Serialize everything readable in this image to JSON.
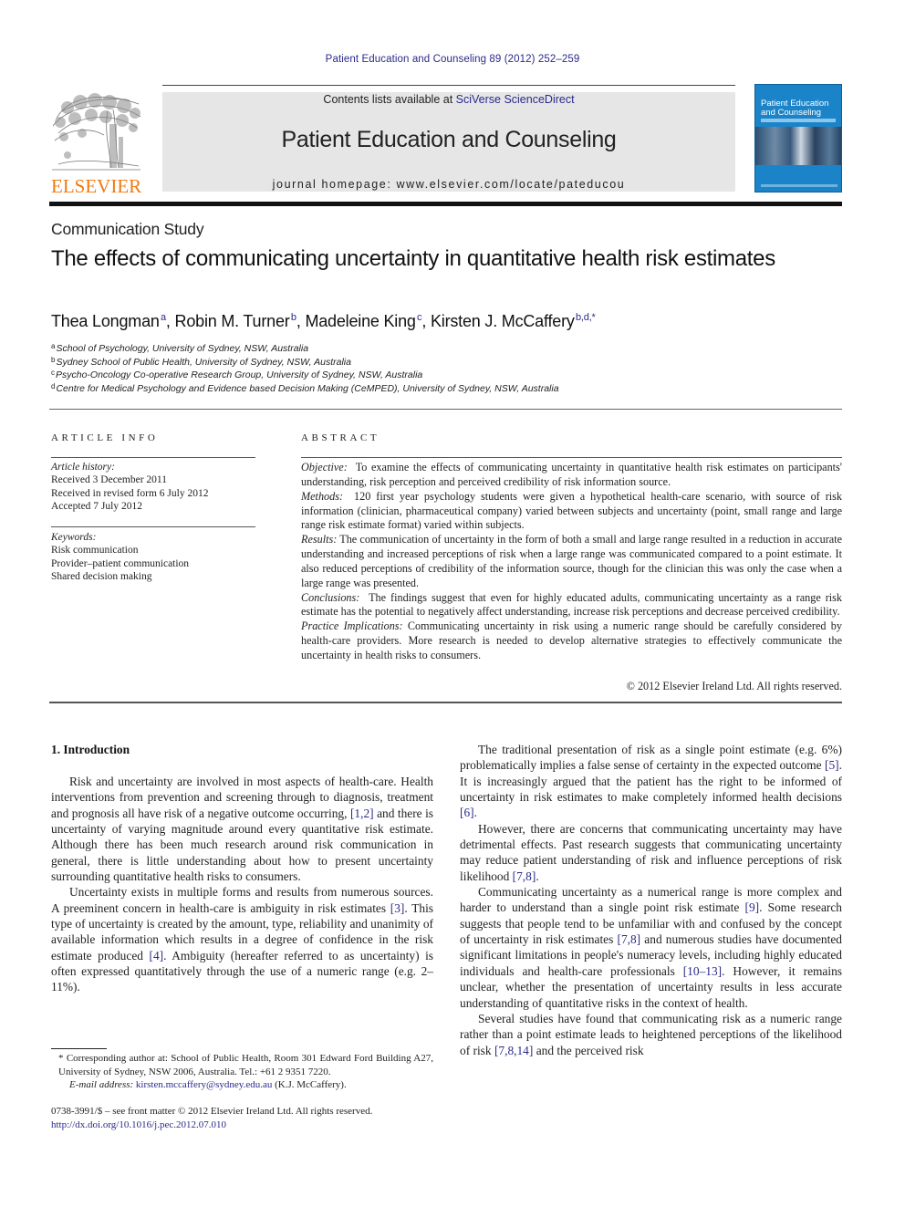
{
  "header": {
    "journal_reference": "Patient Education and Counseling 89 (2012) 252–259",
    "contents_prefix": "Contents lists available at ",
    "contents_link": "SciVerse ScienceDirect",
    "journal_title": "Patient Education and Counseling",
    "homepage": "journal homepage: www.elsevier.com/locate/pateducou",
    "publisher_logo_text": "ELSEVIER",
    "cover": {
      "title_line1": "Patient Education",
      "title_line2": "and Counseling"
    },
    "colors": {
      "link": "#2a2a8c",
      "elsevier_orange": "#f07a10",
      "cover_blue": "#1b84c8"
    }
  },
  "article": {
    "section_type": "Communication Study",
    "title": "The effects of communicating uncertainty in quantitative health risk estimates",
    "authors": [
      {
        "name": "Thea Longman",
        "sup": "a",
        "sep": ", "
      },
      {
        "name": "Robin M. Turner",
        "sup": "b",
        "sep": ", "
      },
      {
        "name": "Madeleine King",
        "sup": "c",
        "sep": ", "
      },
      {
        "name": "Kirsten J. McCaffery",
        "sup": "b,d,*",
        "sep": ""
      }
    ],
    "affiliations": [
      {
        "sup": "a",
        "text": "School of Psychology, University of Sydney, NSW, Australia"
      },
      {
        "sup": "b",
        "text": "Sydney School of Public Health, University of Sydney, NSW, Australia"
      },
      {
        "sup": "c",
        "text": "Psycho-Oncology Co-operative Research Group, University of Sydney, NSW, Australia"
      },
      {
        "sup": "d",
        "text": "Centre for Medical Psychology and Evidence based Decision Making (CeMPED), University of Sydney, NSW, Australia"
      }
    ]
  },
  "article_info": {
    "heading": "ARTICLE INFO",
    "history_label": "Article history:",
    "history": [
      "Received 3 December 2011",
      "Received in revised form 6 July 2012",
      "Accepted 7 July 2012"
    ],
    "keywords_label": "Keywords:",
    "keywords": [
      "Risk communication",
      "Provider–patient communication",
      "Shared decision making"
    ]
  },
  "abstract": {
    "heading": "ABSTRACT",
    "sections": [
      {
        "label": "Objective:",
        "text": "To examine the effects of communicating uncertainty in quantitative health risk estimates on participants' understanding, risk perception and perceived credibility of risk information source."
      },
      {
        "label": "Methods:",
        "text": "120 first year psychology students were given a hypothetical health-care scenario, with source of risk information (clinician, pharmaceutical company) varied between subjects and uncertainty (point, small range and large range risk estimate format) varied within subjects."
      },
      {
        "label": "Results:",
        "text": "The communication of uncertainty in the form of both a small and large range resulted in a reduction in accurate understanding and increased perceptions of risk when a large range was communicated compared to a point estimate. It also reduced perceptions of credibility of the information source, though for the clinician this was only the case when a large range was presented."
      },
      {
        "label": "Conclusions:",
        "text": "The findings suggest that even for highly educated adults, communicating uncertainty as a range risk estimate has the potential to negatively affect understanding, increase risk perceptions and decrease perceived credibility."
      },
      {
        "label": "Practice Implications:",
        "text": "Communicating uncertainty in risk using a numeric range should be carefully considered by health-care providers. More research is needed to develop alternative strategies to effectively communicate the uncertainty in health risks to consumers."
      }
    ],
    "copyright": "© 2012 Elsevier Ireland Ltd. All rights reserved."
  },
  "body": {
    "section_heading": "1.  Introduction",
    "left_paragraphs": [
      [
        {
          "t": "Risk and uncertainty are involved in most aspects of health-care. Health interventions from prevention and screening through to diagnosis, treatment and prognosis all have risk of a negative outcome occurring, "
        },
        {
          "c": "[1,2]"
        },
        {
          "t": " and there is uncertainty of varying magnitude around every quantitative risk estimate. Although there has been much research around risk communication in general, there is little understanding about how to present uncertainty surrounding quantitative health risks to consumers."
        }
      ],
      [
        {
          "t": "Uncertainty exists in multiple forms and results from numerous sources. A preeminent concern in health-care is ambiguity in risk estimates "
        },
        {
          "c": "[3]"
        },
        {
          "t": ". This type of uncertainty is created by the amount, type, reliability and unanimity of available information which results in a degree of confidence in the risk estimate produced "
        },
        {
          "c": "[4]"
        },
        {
          "t": ". Ambiguity (hereafter referred to as uncertainty) is often expressed quantitatively through the use of a numeric range (e.g. 2–11%)."
        }
      ]
    ],
    "right_paragraphs": [
      [
        {
          "t": "The traditional presentation of risk as a single point estimate (e.g. 6%) problematically implies a false sense of certainty in the expected outcome "
        },
        {
          "c": "[5]"
        },
        {
          "t": ". It is increasingly argued that the patient has the right to be informed of uncertainty in risk estimates to make completely informed health decisions "
        },
        {
          "c": "[6]"
        },
        {
          "t": "."
        }
      ],
      [
        {
          "t": "However, there are concerns that communicating uncertainty may have detrimental effects. Past research suggests that communicating uncertainty may reduce patient understanding of risk and influence perceptions of risk likelihood "
        },
        {
          "c": "[7,8]"
        },
        {
          "t": "."
        }
      ],
      [
        {
          "t": "Communicating uncertainty as a numerical range is more complex and harder to understand than a single point risk estimate "
        },
        {
          "c": "[9]"
        },
        {
          "t": ". Some research suggests that people tend to be unfamiliar with and confused by the concept of uncertainty in risk estimates "
        },
        {
          "c": "[7,8]"
        },
        {
          "t": " and numerous studies have documented significant limitations in people's numeracy levels, including highly educated individuals and health-care professionals "
        },
        {
          "c": "[10–13]"
        },
        {
          "t": ". However, it remains unclear, whether the presentation of uncertainty results in less accurate understanding of quantitative risks in the context of health."
        }
      ],
      [
        {
          "t": "Several studies have found that communicating risk as a numeric range rather than a point estimate leads to heightened perceptions of the likelihood of risk "
        },
        {
          "c": "[7,8,14]"
        },
        {
          "t": " and the perceived risk"
        }
      ]
    ]
  },
  "footnote": {
    "corresponding": "* Corresponding author at: School of Public Health, Room 301 Edward Ford Building A27, University of Sydney, NSW 2006, Australia. Tel.: +61 2 9351 7220.",
    "email_label": "E-mail address:",
    "email": "kirsten.mccaffery@sydney.edu.au",
    "email_suffix": " (K.J. McCaffery).",
    "issn_line": "0738-3991/$ – see front matter © 2012 Elsevier Ireland Ltd. All rights reserved.",
    "doi": "http://dx.doi.org/10.1016/j.pec.2012.07.010"
  }
}
